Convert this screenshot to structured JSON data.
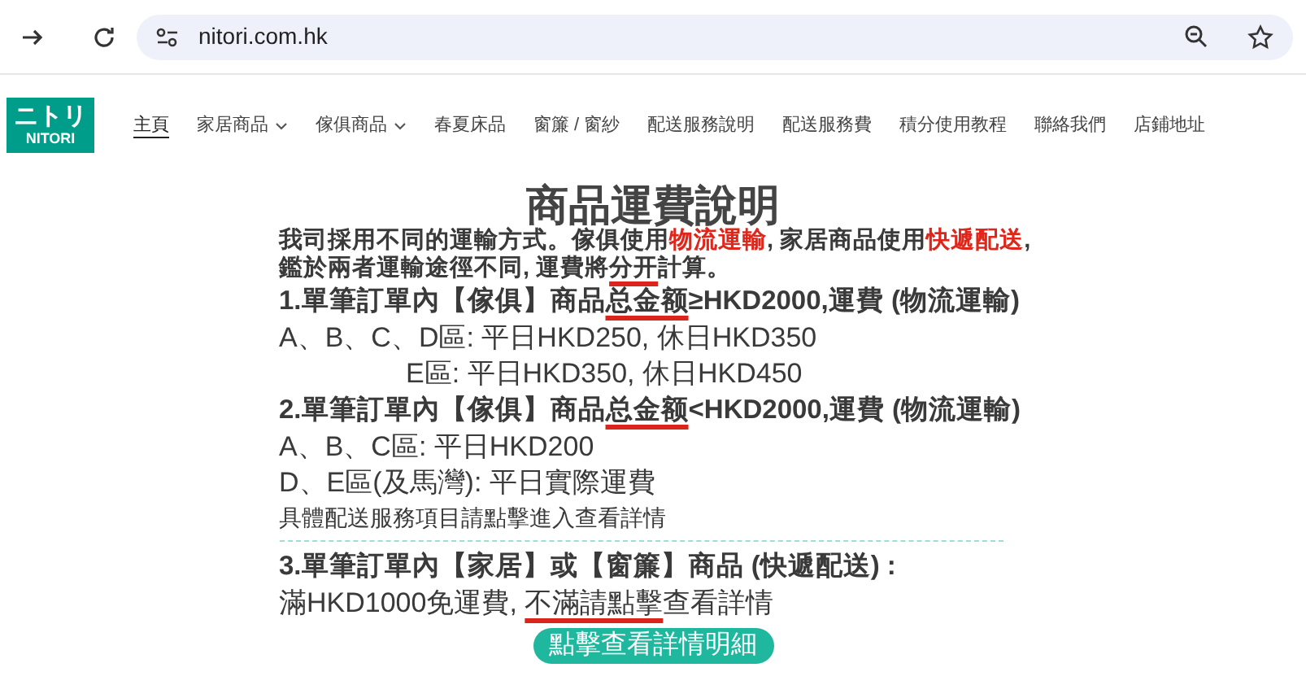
{
  "browser": {
    "url": "nitori.com.hk"
  },
  "logo": {
    "top": "ニトリ",
    "bottom": "NITORI"
  },
  "nav": [
    {
      "label": "主頁",
      "selected": true,
      "dropdown": false
    },
    {
      "label": "家居商品",
      "selected": false,
      "dropdown": true
    },
    {
      "label": "傢俱商品",
      "selected": false,
      "dropdown": true
    },
    {
      "label": "春夏床品",
      "selected": false,
      "dropdown": false
    },
    {
      "label": "窗簾 / 窗紗",
      "selected": false,
      "dropdown": false
    },
    {
      "label": "配送服務說明",
      "selected": false,
      "dropdown": false
    },
    {
      "label": "配送服務費",
      "selected": false,
      "dropdown": false
    },
    {
      "label": "積分使用教程",
      "selected": false,
      "dropdown": false
    },
    {
      "label": "聯絡我們",
      "selected": false,
      "dropdown": false
    },
    {
      "label": "店鋪地址",
      "selected": false,
      "dropdown": false
    }
  ],
  "notice": {
    "title": "商品運費說明",
    "lines": [
      {
        "kind": "intro",
        "segments": [
          {
            "text": "我司採用不同的運輸方式。傢俱使用",
            "kind": "plain"
          },
          {
            "text": "物流運輸",
            "kind": "red"
          },
          {
            "text": ", 家居商品使用",
            "kind": "plain"
          },
          {
            "text": "快遞配送",
            "kind": "red"
          },
          {
            "text": ",",
            "kind": "plain"
          }
        ]
      },
      {
        "kind": "intro",
        "segments": [
          {
            "text": "鑑於兩者運輸途徑不同, 運費將",
            "kind": "plain"
          },
          {
            "text": "分开",
            "kind": "underline"
          },
          {
            "text": "計算。",
            "kind": "plain"
          }
        ]
      },
      {
        "kind": "heading",
        "segments": [
          {
            "text": "1.單筆訂單內【傢俱】商品",
            "kind": "plain"
          },
          {
            "text": "总金额",
            "kind": "underline"
          },
          {
            "text": "≥HKD2000,運費 (物流運輸)",
            "kind": "plain"
          }
        ]
      },
      {
        "kind": "rate",
        "segments": [
          {
            "text": "A、B、C、D區: 平日HKD250, 休日HKD350",
            "kind": "plain"
          }
        ]
      },
      {
        "kind": "indented",
        "segments": [
          {
            "text": "E區: 平日HKD350, 休日HKD450",
            "kind": "plain"
          }
        ]
      },
      {
        "kind": "heading",
        "segments": [
          {
            "text": "2.單筆訂單內【傢俱】商品",
            "kind": "plain"
          },
          {
            "text": "总金额",
            "kind": "underline"
          },
          {
            "text": "<HKD2000,運費 (物流運輸)",
            "kind": "plain"
          }
        ]
      },
      {
        "kind": "rate",
        "segments": [
          {
            "text": "A、B、C區: 平日HKD200",
            "kind": "plain"
          }
        ]
      },
      {
        "kind": "rate",
        "segments": [
          {
            "text": "D、E區(及馬灣): 平日實際運費",
            "kind": "plain"
          }
        ]
      },
      {
        "kind": "note",
        "segments": [
          {
            "text": "具體配送服務項目請點擊進入查看詳情",
            "kind": "plain"
          }
        ]
      },
      {
        "kind": "divider"
      },
      {
        "kind": "heading",
        "segments": [
          {
            "text": "3.單筆訂單內【家居】或【窗簾】商品 (快遞配送) :",
            "kind": "plain"
          }
        ]
      },
      {
        "kind": "rate",
        "segments": [
          {
            "text": "滿HKD1000免運費, ",
            "kind": "plain"
          },
          {
            "text": "不滿請點擊",
            "kind": "underline"
          },
          {
            "text": "查看詳情",
            "kind": "plain"
          }
        ]
      }
    ],
    "button": "點擊查看詳情明細"
  }
}
